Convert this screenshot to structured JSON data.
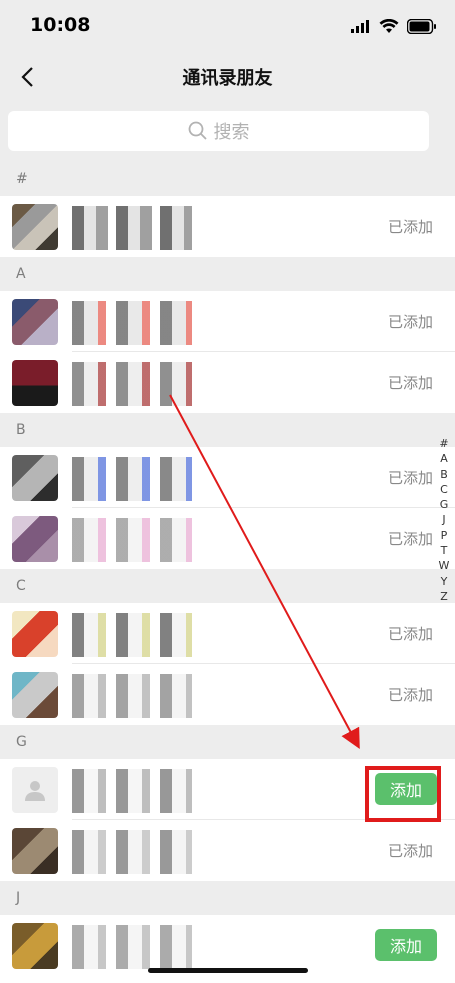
{
  "status_bar": {
    "time": "10:08",
    "icons": [
      "signal-icon",
      "wifi-icon",
      "battery-icon"
    ]
  },
  "nav": {
    "title": "通讯录朋友",
    "back_icon": "chevron-left-icon"
  },
  "search": {
    "placeholder": "搜索",
    "icon": "search-icon"
  },
  "sections": [
    {
      "letter": "#",
      "rows": [
        {
          "status": "已添加"
        }
      ]
    },
    {
      "letter": "A",
      "rows": [
        {
          "status": "已添加"
        },
        {
          "status": "已添加"
        }
      ]
    },
    {
      "letter": "B",
      "rows": [
        {
          "status": "已添加"
        },
        {
          "status": "已添加"
        }
      ]
    },
    {
      "letter": "C",
      "rows": [
        {
          "status": "已添加"
        },
        {
          "status": "已添加"
        }
      ]
    },
    {
      "letter": "G",
      "rows": [
        {
          "button": "添加"
        },
        {
          "status": "已添加"
        }
      ]
    },
    {
      "letter": "J",
      "rows": [
        {
          "button": "添加"
        }
      ]
    }
  ],
  "index_letters": [
    "#",
    "A",
    "B",
    "C",
    "G",
    "J",
    "P",
    "T",
    "W",
    "Y",
    "Z"
  ],
  "colors": {
    "accent_green": "#5bc06c",
    "annotation_red": "#e01b1b",
    "background_gray": "#ededed"
  }
}
